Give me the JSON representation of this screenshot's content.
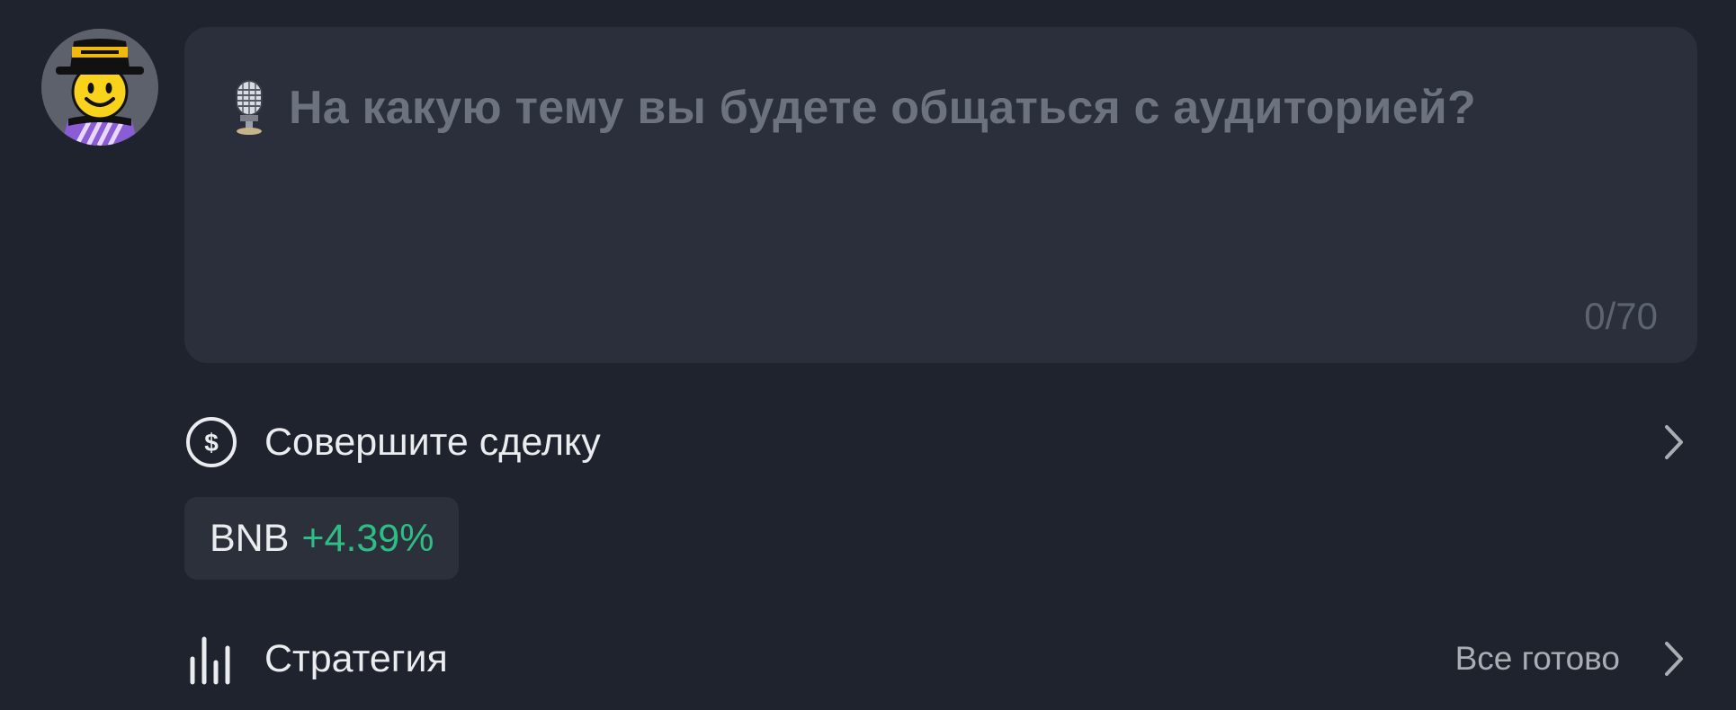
{
  "composer": {
    "placeholder": "На какую тему вы будете общаться с аудиторией?",
    "counter": "0/70",
    "icon": "microphone-icon"
  },
  "options": {
    "trade": {
      "label": "Совершите сделку",
      "icon": "dollar-circle-icon"
    },
    "token": {
      "symbol": "BNB",
      "change": "+4.39%"
    },
    "strategy": {
      "label": "Стратегия",
      "status": "Все готово",
      "icon": "bar-chart-icon"
    }
  },
  "colors": {
    "background": "#1f232d",
    "card": "#2a2f3b",
    "positive": "#2ebd85",
    "text": "#eaecef",
    "muted": "#6d737e"
  }
}
